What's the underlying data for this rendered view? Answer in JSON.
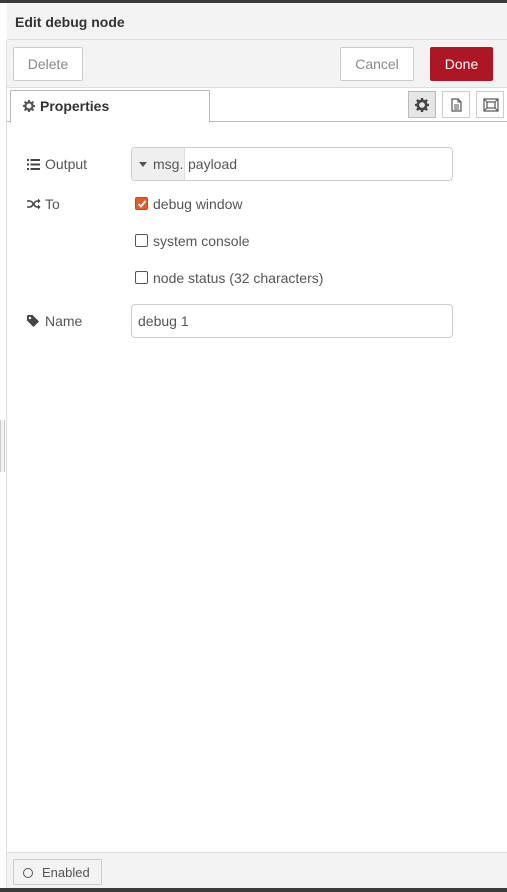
{
  "tray": {
    "title": "Edit debug node"
  },
  "toolbar": {
    "delete_label": "Delete",
    "cancel_label": "Cancel",
    "done_label": "Done",
    "done_color": "#ad1625"
  },
  "tabs": {
    "properties_label": "Properties",
    "icons": [
      "gear-icon",
      "description-icon",
      "appearance-icon"
    ]
  },
  "form": {
    "output": {
      "label": "Output",
      "type_prefix": "msg.",
      "value": "payload"
    },
    "to": {
      "label": "To",
      "options": [
        {
          "label": "debug window",
          "checked": true
        },
        {
          "label": "system console",
          "checked": false
        },
        {
          "label": "node status (32 characters)",
          "checked": false
        }
      ]
    },
    "name": {
      "label": "Name",
      "value": "debug 1"
    }
  },
  "footer": {
    "enabled_label": "Enabled"
  },
  "colors": {
    "accent": "#ad1625",
    "checkbox_checked": "#e05c2b"
  }
}
